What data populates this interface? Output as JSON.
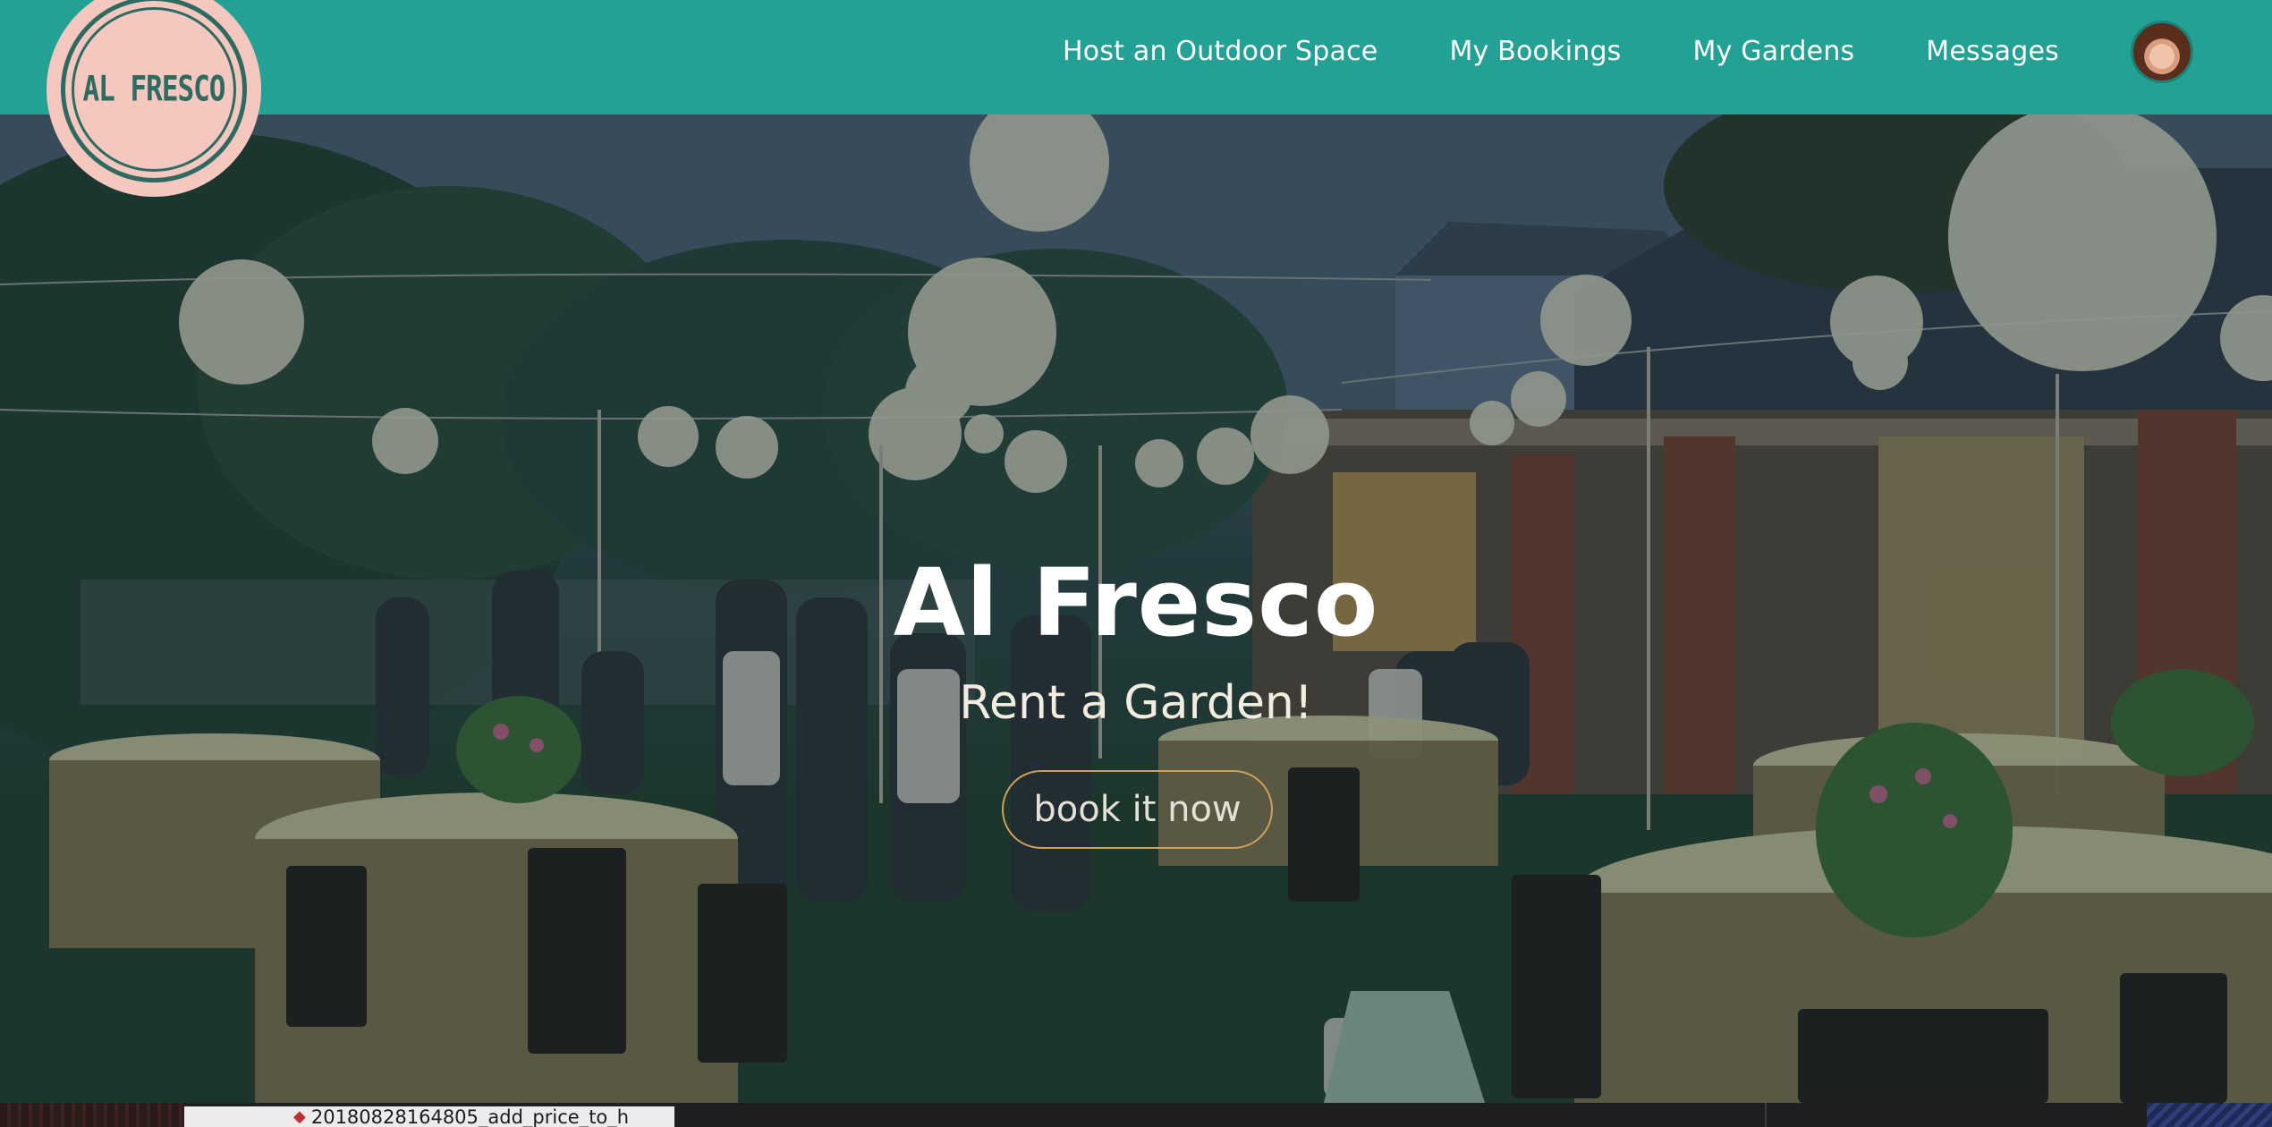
{
  "brand": {
    "logo_text": "AL FRESCO"
  },
  "nav": {
    "links": [
      {
        "label": "Host an Outdoor Space"
      },
      {
        "label": "My Bookings"
      },
      {
        "label": "My Gardens"
      },
      {
        "label": "Messages"
      }
    ]
  },
  "hero": {
    "title": "Al Fresco",
    "subtitle": "Rent a Garden!",
    "cta_label": "book it now"
  },
  "taskbar": {
    "tab_label": "20180828164805_add_price_to_h"
  },
  "colors": {
    "navbar": "#23a195",
    "logo_badge": "#f4c7bf",
    "logo_ink": "#2d6a61",
    "cta_border": "#d2a055"
  },
  "icons": {
    "avatar": "user-avatar-photo",
    "task_tab": "ruby-gem-icon"
  }
}
